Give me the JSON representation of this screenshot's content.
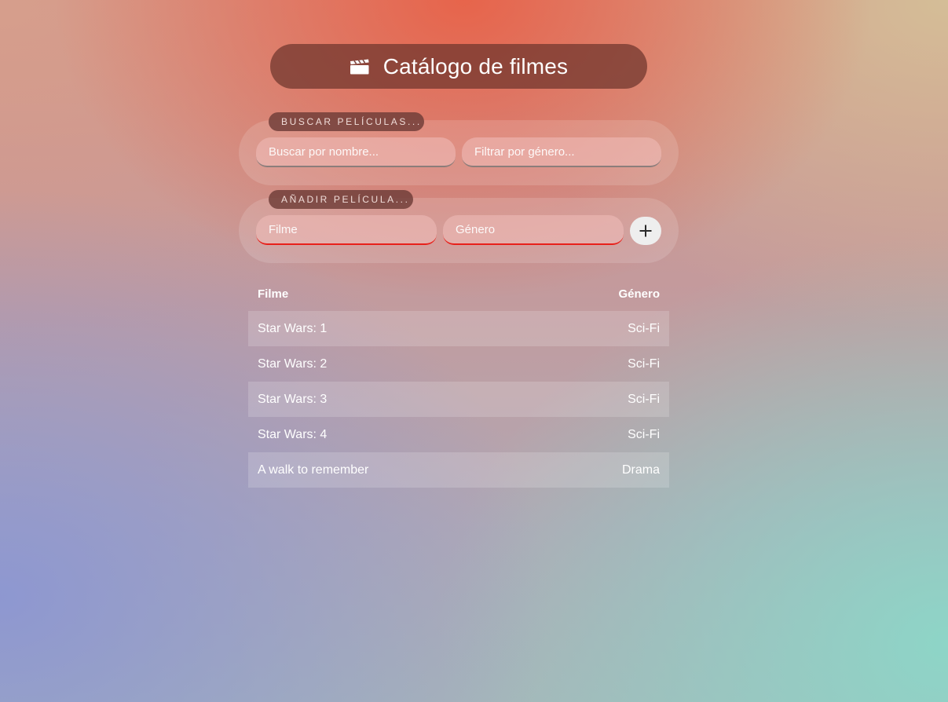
{
  "header": {
    "icon": "clapperboard-icon",
    "title": "Catálogo de filmes"
  },
  "search_section": {
    "label": "BUSCAR PELÍCULAS...",
    "name_placeholder": "Buscar por nombre...",
    "genre_placeholder": "Filtrar por género..."
  },
  "add_section": {
    "label": "AÑADIR PELÍCULA...",
    "film_placeholder": "Filme",
    "genre_placeholder": "Género",
    "add_icon": "plus-icon"
  },
  "table": {
    "columns": [
      "Filme",
      "Género"
    ],
    "rows": [
      {
        "film": "Star Wars: 1",
        "genre": "Sci-Fi"
      },
      {
        "film": "Star Wars: 2",
        "genre": "Sci-Fi"
      },
      {
        "film": "Star Wars: 3",
        "genre": "Sci-Fi"
      },
      {
        "film": "Star Wars: 4",
        "genre": "Sci-Fi"
      },
      {
        "film": "A walk to remember",
        "genre": "Drama"
      }
    ]
  },
  "colors": {
    "required_underline": "#e8201a",
    "title_pill": "#6e342d"
  }
}
